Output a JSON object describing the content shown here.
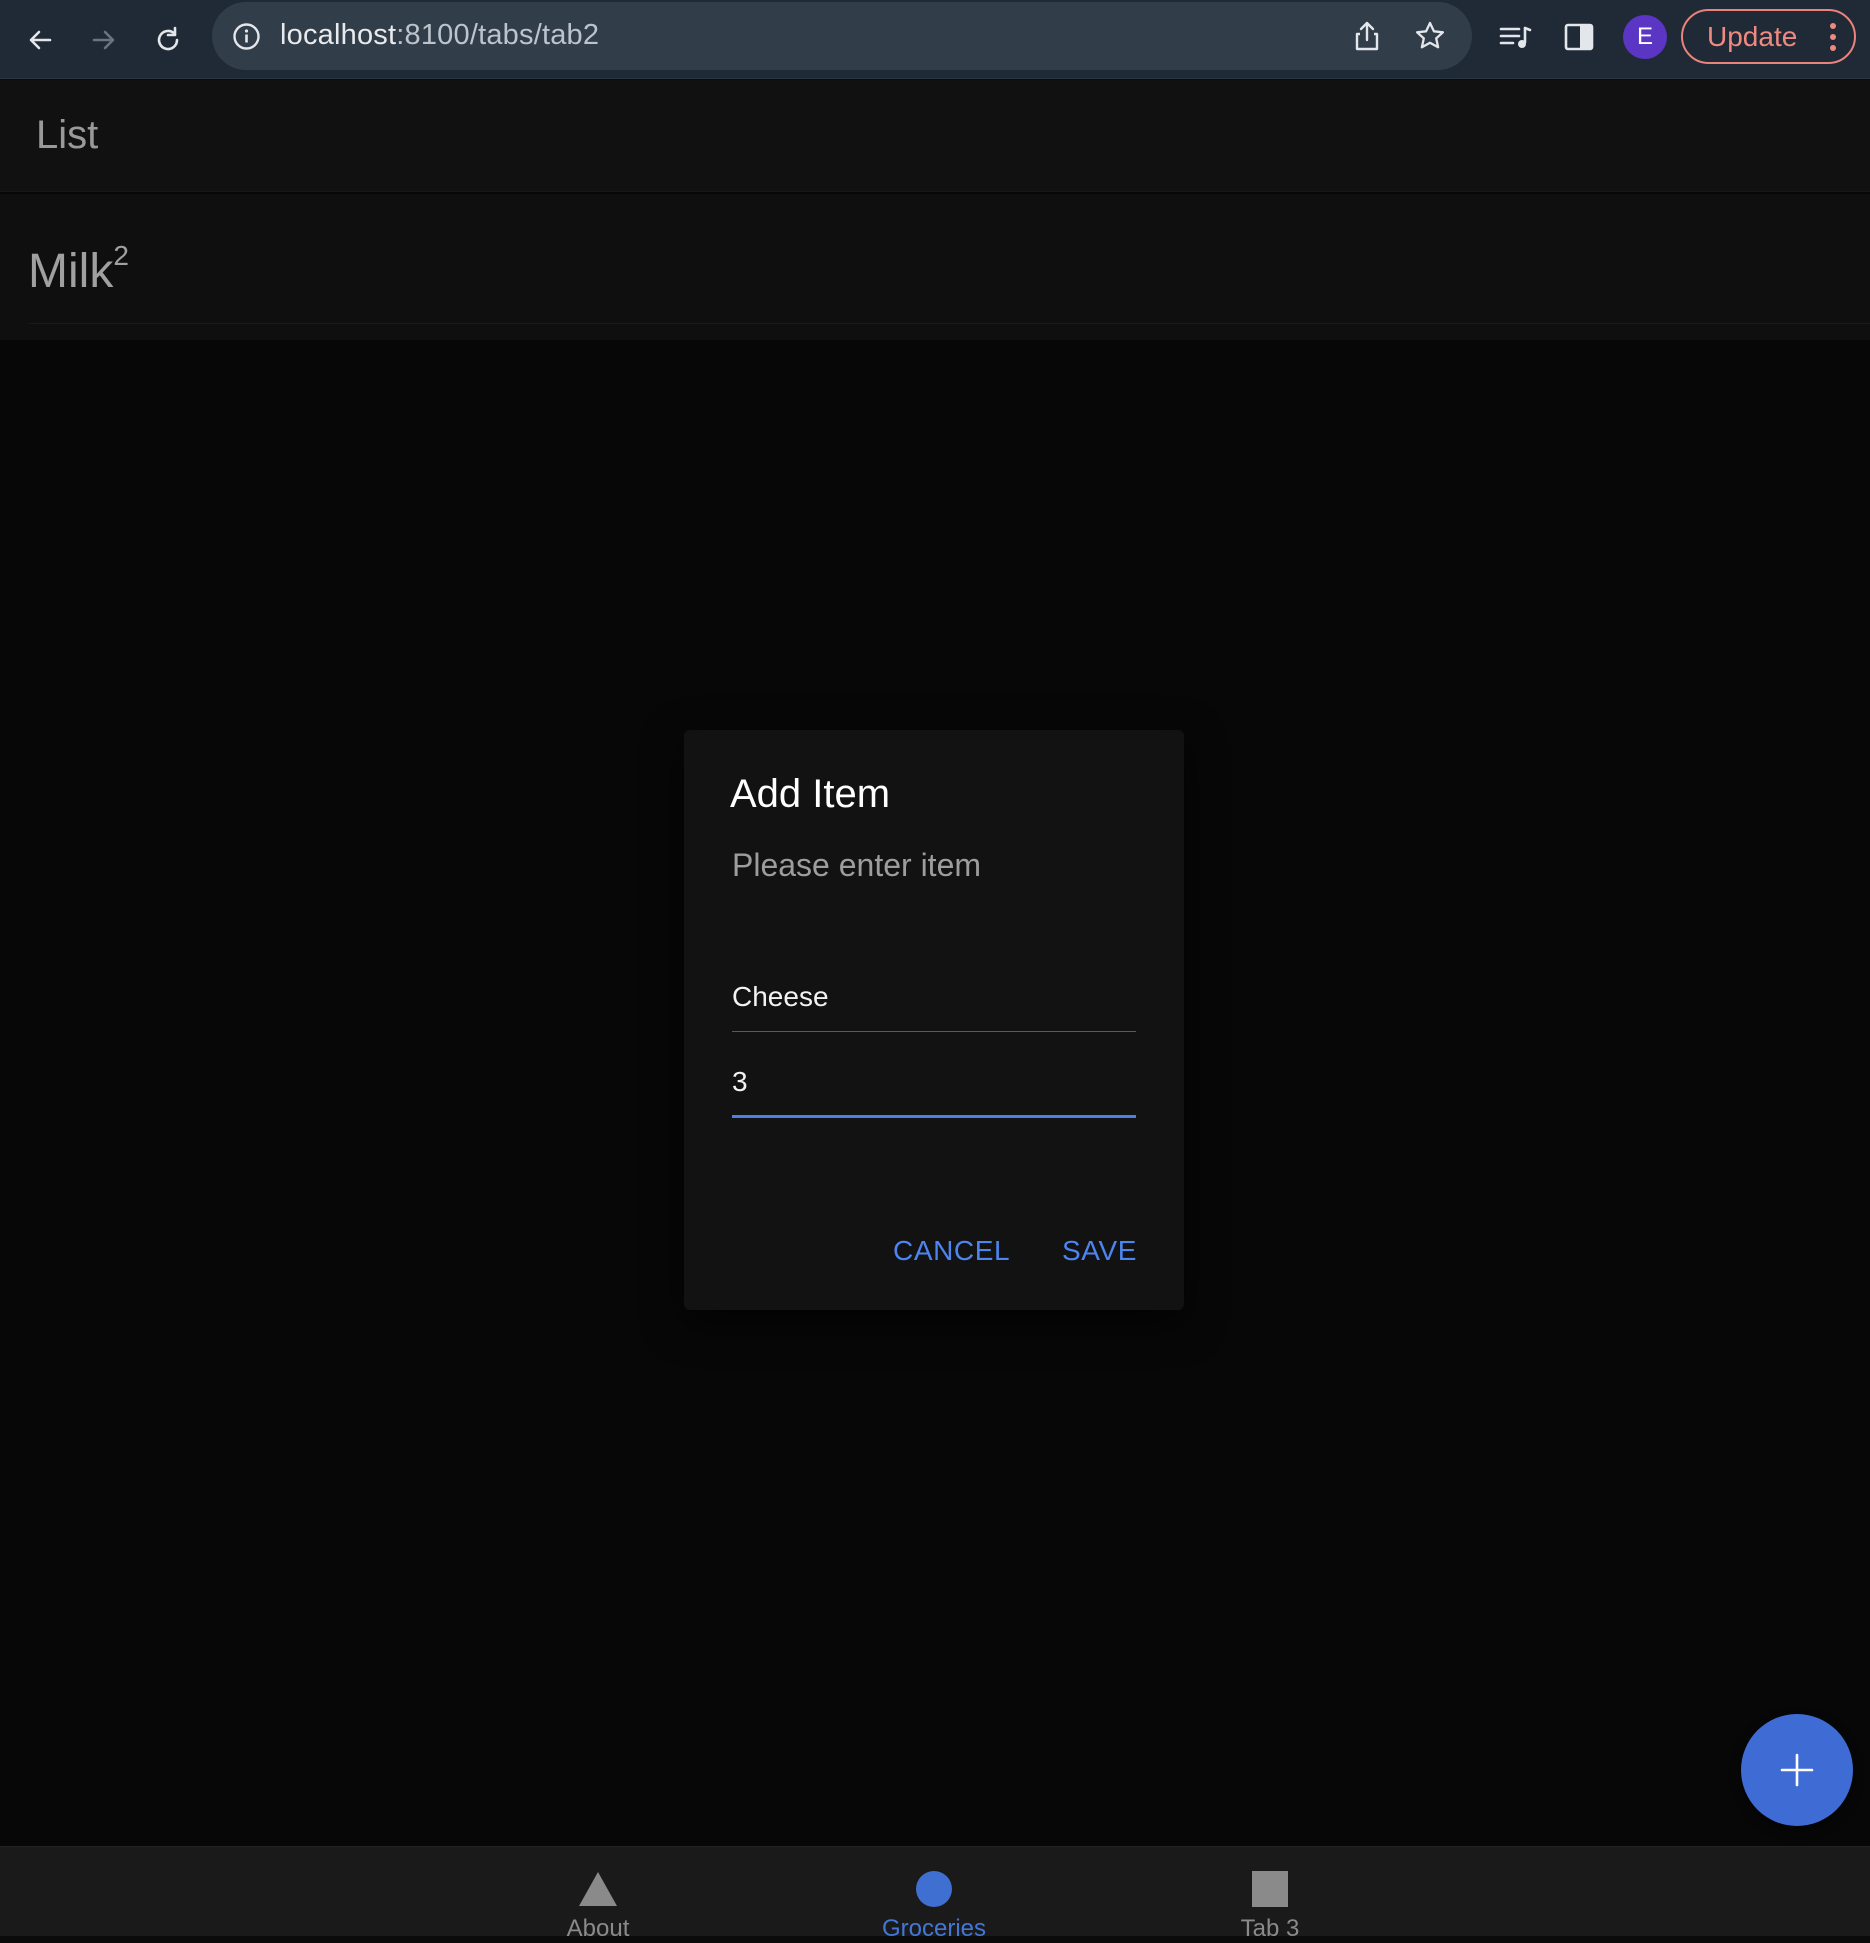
{
  "browser": {
    "url_host": "localhost",
    "url_rest": ":8100/tabs/tab2",
    "profile_initial": "E",
    "update_label": "Update"
  },
  "header": {
    "title": "List"
  },
  "list": {
    "items": [
      {
        "name": "Milk",
        "quantity": "2"
      }
    ]
  },
  "dialog": {
    "title": "Add Item",
    "message": "Please enter item",
    "name_value": "Cheese",
    "quantity_value": "3",
    "cancel_label": "CANCEL",
    "save_label": "SAVE"
  },
  "tabs": [
    {
      "label": "About",
      "icon": "triangle-icon",
      "active": false
    },
    {
      "label": "Groceries",
      "icon": "ellipse-icon",
      "active": true
    },
    {
      "label": "Tab 3",
      "icon": "square-icon",
      "active": false
    }
  ],
  "colors": {
    "accent": "#4c84f0",
    "fab": "#3e6cd4",
    "update_border": "#e9837b",
    "avatar": "#5b35c4"
  }
}
